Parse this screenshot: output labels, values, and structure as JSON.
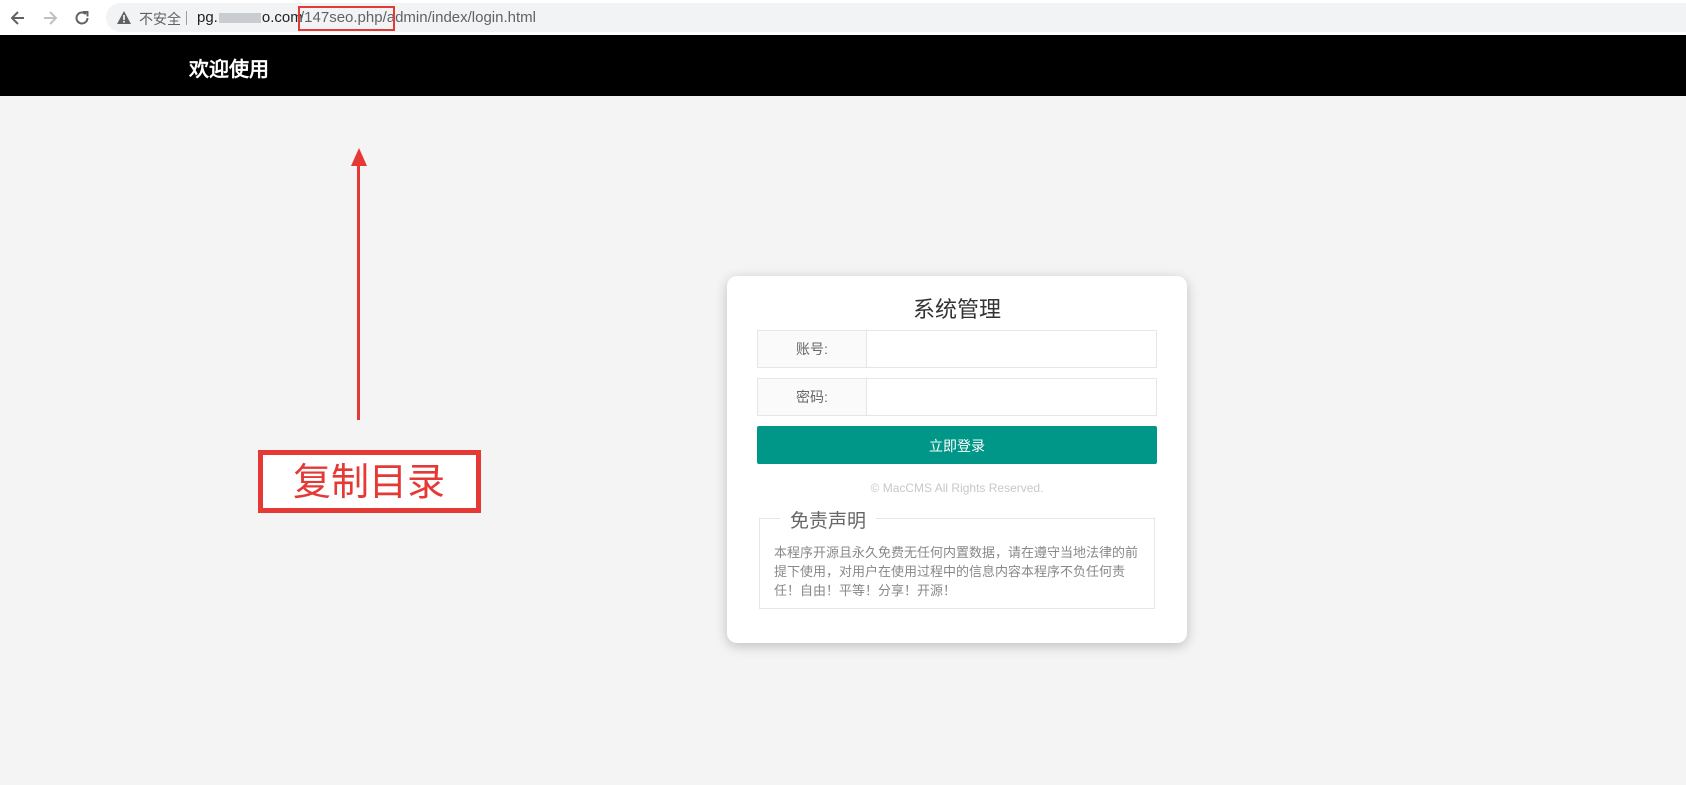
{
  "browser": {
    "security_label": "不安全",
    "url_domain_start": "pg.",
    "url_domain_end": "o.com",
    "url_path": "/147seo.php/admin/index/login.html"
  },
  "header": {
    "title": "欢迎使用"
  },
  "annotation": {
    "label": "复制目录",
    "color": "#e53935"
  },
  "login": {
    "title": "系统管理",
    "username_label": "账号:",
    "username_value": "",
    "password_label": "密码:",
    "password_value": "",
    "submit_label": "立即登录",
    "copyright": "© MacCMS All Rights Reserved.",
    "button_color": "#009688"
  },
  "disclaimer": {
    "title": "免责声明",
    "text": "本程序开源且永久免费无任何内置数据，请在遵守当地法律的前提下使用，对用户在使用过程中的信息内容本程序不负任何责任！自由！平等！分享！开源！"
  },
  "icons": {
    "back": "arrow-left-icon",
    "forward": "arrow-right-icon",
    "reload": "reload-icon",
    "warning": "warning-triangle-icon"
  }
}
